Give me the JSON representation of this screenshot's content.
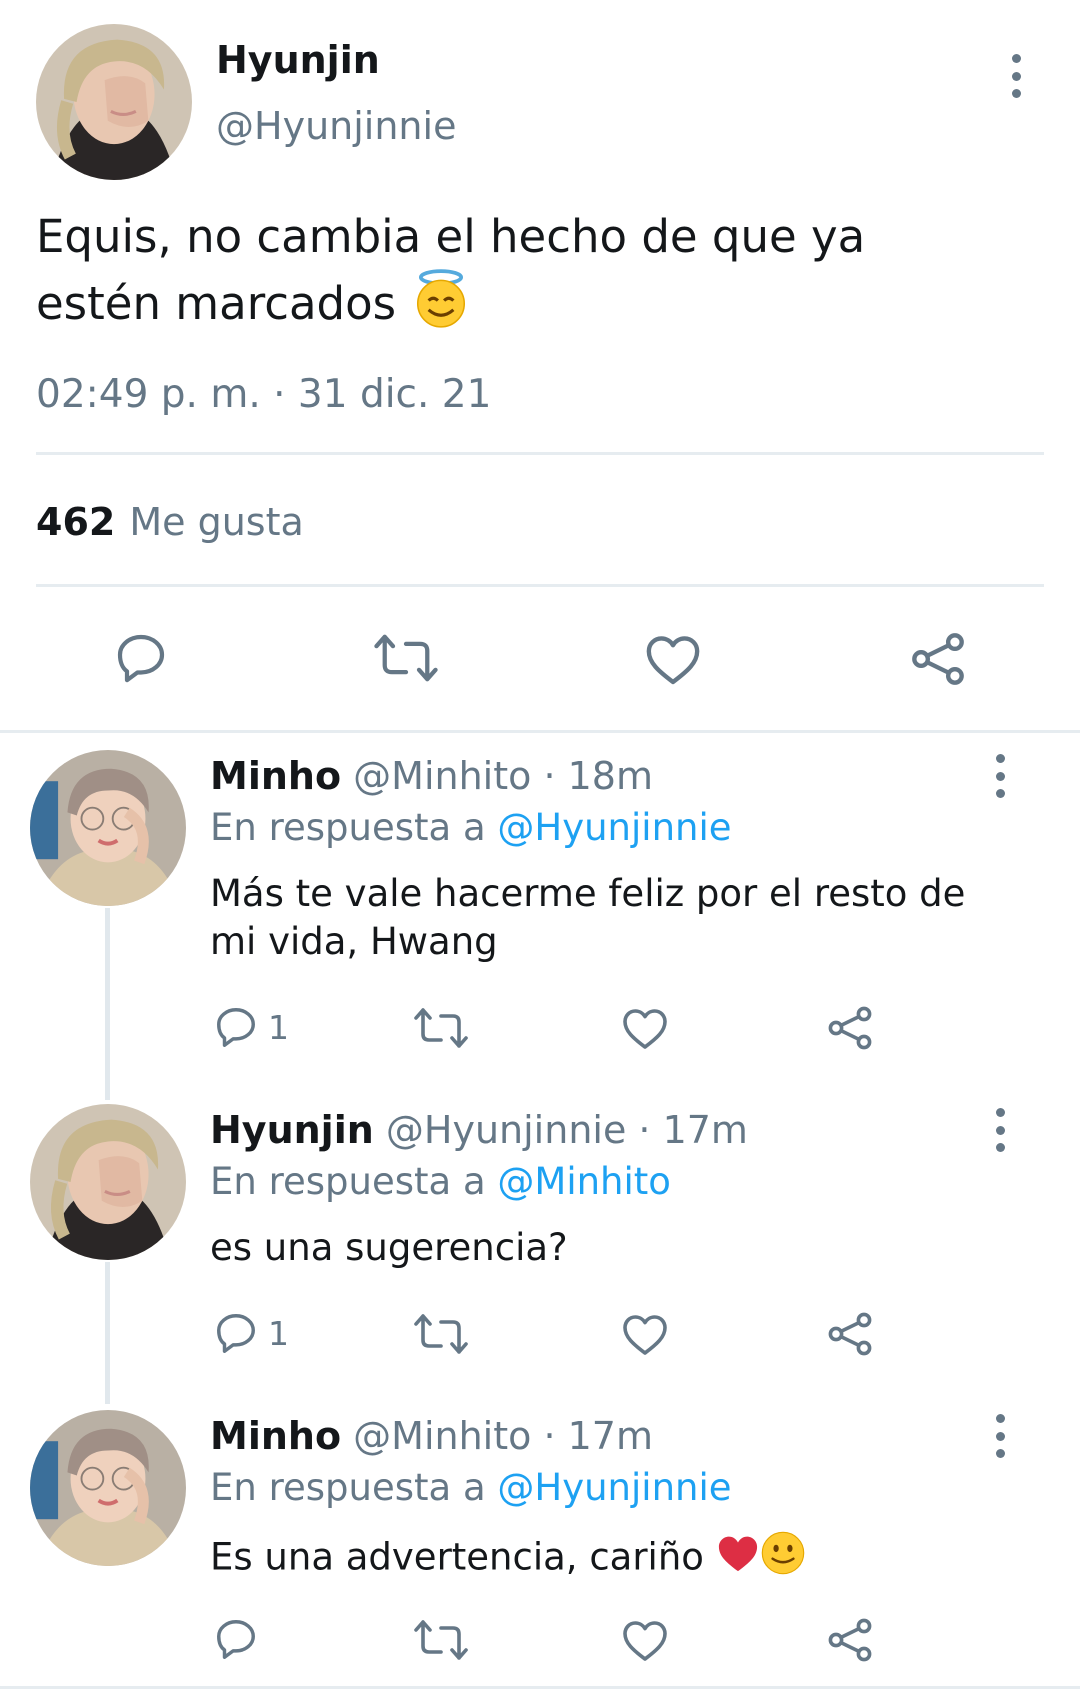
{
  "main_tweet": {
    "name": "Hyunjin",
    "handle": "@Hyunjinnie",
    "text": "Equis, no cambia el hecho de que ya estén marcados",
    "emoji": "innocent-face",
    "timestamp": "02:49 p. m. · 31 dic. 21",
    "likes_count": "462",
    "likes_label": "Me gusta"
  },
  "replies": [
    {
      "name": "Minho",
      "handle_time": "@Minhito · 18m",
      "reply_prefix": "En respuesta a",
      "reply_to": "@Hyunjinnie",
      "text": "Más te vale hacerme feliz por el resto de mi vida, Hwang",
      "reply_count": "1"
    },
    {
      "name": "Hyunjin",
      "handle_time": "@Hyunjinnie · 17m",
      "reply_prefix": "En respuesta a",
      "reply_to": "@Minhito",
      "text": "es una sugerencia?",
      "reply_count": "1"
    },
    {
      "name": "Minho",
      "handle_time": "@Minhito · 17m",
      "reply_prefix": "En respuesta a",
      "reply_to": "@Hyunjinnie",
      "text": "Es una advertencia, cariño",
      "emojis": [
        "red-heart",
        "slightly-smiling-face"
      ],
      "reply_count": ""
    }
  ],
  "colors": {
    "text": "#14171a",
    "secondary": "#657786",
    "link": "#1da1f2",
    "divider": "#e6ecf0"
  }
}
